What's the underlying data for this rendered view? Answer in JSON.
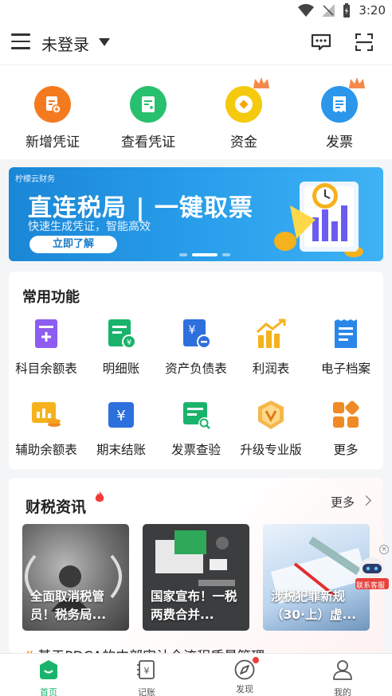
{
  "status_bar": {
    "time": "3:20"
  },
  "top_bar": {
    "account_label": "未登录"
  },
  "quick_actions": [
    {
      "label": "新增凭证",
      "icon": "add-voucher-icon",
      "color": "#f47a1f"
    },
    {
      "label": "查看凭证",
      "icon": "view-voucher-icon",
      "color": "#27c06e"
    },
    {
      "label": "资金",
      "icon": "funds-icon",
      "color": "#f5c90e"
    },
    {
      "label": "发票",
      "icon": "invoice-icon",
      "color": "#2b96ea"
    }
  ],
  "banner": {
    "brand": "柠檬云财务",
    "headline": "直连税局 | 一键取票",
    "subline": "快速生成凭证，智能高效",
    "button": "立即了解"
  },
  "features": {
    "title": "常用功能",
    "items": [
      {
        "label": "科目余额表",
        "icon": "account-balance-icon"
      },
      {
        "label": "明细账",
        "icon": "detail-ledger-icon"
      },
      {
        "label": "资产负债表",
        "icon": "balance-sheet-icon"
      },
      {
        "label": "利润表",
        "icon": "profit-chart-icon"
      },
      {
        "label": "电子档案",
        "icon": "e-archive-icon"
      },
      {
        "label": "辅助余额表",
        "icon": "aux-balance-icon"
      },
      {
        "label": "期末结账",
        "icon": "period-close-icon"
      },
      {
        "label": "发票查验",
        "icon": "invoice-check-icon"
      },
      {
        "label": "升级专业版",
        "icon": "upgrade-pro-icon"
      },
      {
        "label": "更多",
        "icon": "more-grid-icon"
      }
    ]
  },
  "news": {
    "title": "财税资讯",
    "more": "更多",
    "articles": [
      {
        "caption": "全面取消税管员！税务局..."
      },
      {
        "caption": "国家宣布！一税两费合并..."
      },
      {
        "caption": "涉税犯罪新规（30·上）虚..."
      }
    ],
    "ticker": "基于PDCA的内部审计全流程质量管理"
  },
  "support_badge": "联系客服",
  "tabs": [
    {
      "label": "首页",
      "active": true,
      "icon": "home-icon"
    },
    {
      "label": "记账",
      "active": false,
      "icon": "ledger-icon"
    },
    {
      "label": "发现",
      "active": false,
      "icon": "compass-icon",
      "dot": true
    },
    {
      "label": "我的",
      "active": false,
      "icon": "user-icon"
    }
  ]
}
